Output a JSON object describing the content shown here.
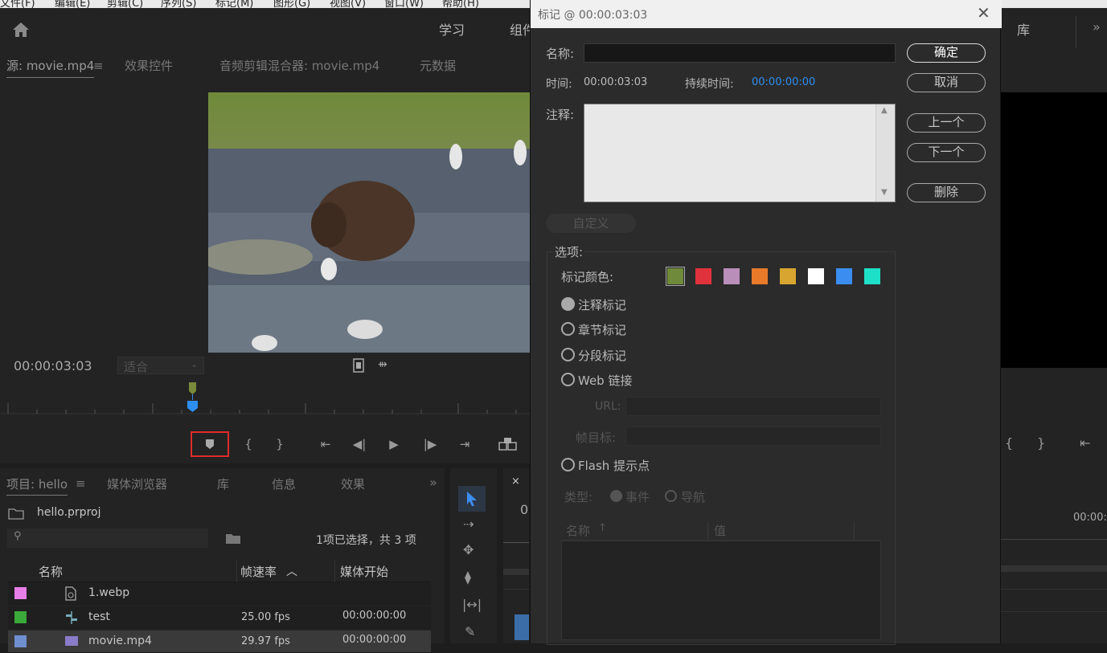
{
  "menubar": [
    "文件(F)",
    "编辑(E)",
    "剪辑(C)",
    "序列(S)",
    "标记(M)",
    "图形(G)",
    "视图(V)",
    "窗口(W)",
    "帮助(H)"
  ],
  "header": {
    "workspace_tabs": [
      "学习",
      "组件"
    ],
    "right_tab": "库",
    "more": "»"
  },
  "source": {
    "tabs": [
      "源: movie.mp4",
      "效果控件",
      "音频剪辑混合器: movie.mp4",
      "元数据"
    ],
    "timecode": "00:00:03:03",
    "fit": "适合"
  },
  "project": {
    "tabs": [
      "项目: hello",
      "媒体浏览器",
      "库",
      "信息",
      "效果"
    ],
    "file": "hello.prproj",
    "selection": "1项已选择，共 3 项",
    "columns": [
      "名称",
      "帧速率",
      "媒体开始"
    ],
    "rows": [
      {
        "name": "1.webp",
        "fps": "",
        "start": "",
        "color": "#e87ee8"
      },
      {
        "name": "test",
        "fps": "25.00 fps",
        "start": "00:00:00:00",
        "color": "#3aaa3a"
      },
      {
        "name": "movie.mp4",
        "fps": "29.97 fps",
        "start": "00:00:00:00",
        "color": "#6f8fd0"
      }
    ]
  },
  "timeline": {
    "close": "×",
    "timecode_partial": "0",
    "right_timecode": "00:00:"
  },
  "dialog": {
    "title": "标记 @ 00:00:03:03",
    "name_label": "名称:",
    "name_value": "",
    "time_label": "时间:",
    "time_value": "00:00:03:03",
    "duration_label": "持续时间:",
    "duration_value": "00:00:00:00",
    "notes_label": "注释:",
    "notes_value": "",
    "buttons": {
      "ok": "确定",
      "cancel": "取消",
      "prev": "上一个",
      "next": "下一个",
      "delete": "删除"
    },
    "custom": "自定义",
    "options_label": "选项:",
    "color_label": "标记颜色:",
    "colors": [
      "#6f8a3a",
      "#e0323c",
      "#b98fb9",
      "#e87a2a",
      "#d8a531",
      "#ffffff",
      "#3b8df0",
      "#1ee0c8"
    ],
    "types": [
      "注释标记",
      "章节标记",
      "分段标记",
      "Web 链接"
    ],
    "url_label": "URL:",
    "frame_target_label": "帧目标:",
    "flash_label": "Flash 提示点",
    "type_label": "类型:",
    "event_label": "事件",
    "nav_label": "导航",
    "table_cols": [
      "名称",
      "值"
    ]
  }
}
